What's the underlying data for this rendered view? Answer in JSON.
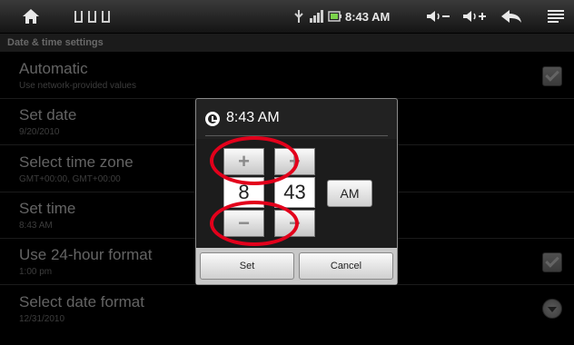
{
  "status_bar": {
    "time": "8:43 AM",
    "icons": [
      "home-icon",
      "notification-icon",
      "usb-icon",
      "signal-icon",
      "battery-icon",
      "volume-down-icon",
      "volume-up-icon",
      "back-icon",
      "menu-icon"
    ]
  },
  "header": {
    "title": "Date & time settings"
  },
  "settings": [
    {
      "title": "Automatic",
      "subtitle": "Use network-provided values"
    },
    {
      "title": "Set date",
      "subtitle": "9/20/2010"
    },
    {
      "title": "Select time zone",
      "subtitle": "GMT+00:00, GMT+00:00"
    },
    {
      "title": "Set time",
      "subtitle": "8:43 AM"
    },
    {
      "title": "Use 24-hour format",
      "subtitle": "1:00 pm"
    },
    {
      "title": "Select date format",
      "subtitle": "12/31/2010"
    }
  ],
  "dialog": {
    "title": "8:43 AM",
    "hour": "8",
    "minute": "43",
    "am_pm": "AM",
    "increment_glyph": "+",
    "decrement_glyph": "−",
    "set_label": "Set",
    "cancel_label": "Cancel"
  },
  "colors": {
    "annotation": "#e3001b",
    "background": "#000000",
    "dialog": "#222222"
  }
}
